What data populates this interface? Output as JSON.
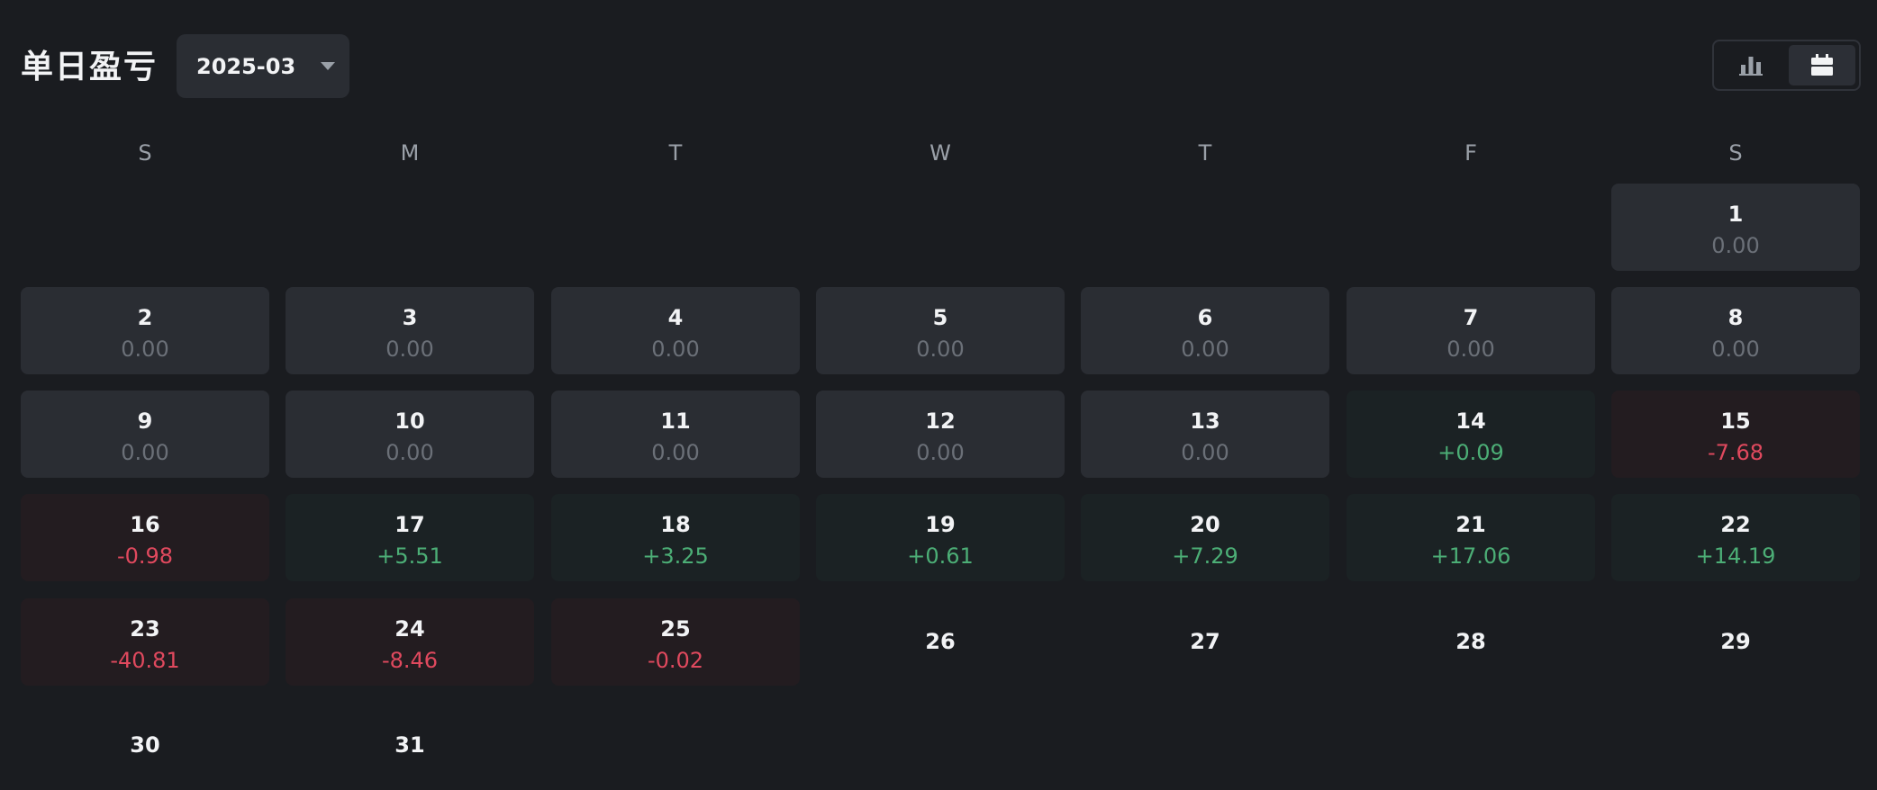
{
  "header": {
    "title": "单日盈亏",
    "month_select": {
      "value": "2025-03",
      "icon": "caret-down-icon"
    },
    "view_toggle": [
      {
        "name": "bar-chart-view",
        "icon": "bar-chart-icon",
        "active": false
      },
      {
        "name": "calendar-view",
        "icon": "calendar-icon",
        "active": true
      }
    ]
  },
  "weekdays": [
    "S",
    "M",
    "T",
    "W",
    "T",
    "F",
    "S"
  ],
  "colors": {
    "background": "#1a1c20",
    "cell_neutral": "#2a2d33",
    "cell_positive": "#1b2224",
    "cell_negative": "#231c20",
    "text_positive": "#4cae76",
    "text_negative": "#e0495e",
    "text_muted": "#6b7078"
  },
  "calendar": {
    "first_weekday_index": 6,
    "days": [
      {
        "day": "1",
        "pnl": "0.00",
        "status": "neutral"
      },
      {
        "day": "2",
        "pnl": "0.00",
        "status": "neutral"
      },
      {
        "day": "3",
        "pnl": "0.00",
        "status": "neutral"
      },
      {
        "day": "4",
        "pnl": "0.00",
        "status": "neutral"
      },
      {
        "day": "5",
        "pnl": "0.00",
        "status": "neutral"
      },
      {
        "day": "6",
        "pnl": "0.00",
        "status": "neutral"
      },
      {
        "day": "7",
        "pnl": "0.00",
        "status": "neutral"
      },
      {
        "day": "8",
        "pnl": "0.00",
        "status": "neutral"
      },
      {
        "day": "9",
        "pnl": "0.00",
        "status": "neutral"
      },
      {
        "day": "10",
        "pnl": "0.00",
        "status": "neutral"
      },
      {
        "day": "11",
        "pnl": "0.00",
        "status": "neutral"
      },
      {
        "day": "12",
        "pnl": "0.00",
        "status": "neutral"
      },
      {
        "day": "13",
        "pnl": "0.00",
        "status": "neutral"
      },
      {
        "day": "14",
        "pnl": "+0.09",
        "status": "pos"
      },
      {
        "day": "15",
        "pnl": "-7.68",
        "status": "neg"
      },
      {
        "day": "16",
        "pnl": "-0.98",
        "status": "neg"
      },
      {
        "day": "17",
        "pnl": "+5.51",
        "status": "pos"
      },
      {
        "day": "18",
        "pnl": "+3.25",
        "status": "pos"
      },
      {
        "day": "19",
        "pnl": "+0.61",
        "status": "pos"
      },
      {
        "day": "20",
        "pnl": "+7.29",
        "status": "pos"
      },
      {
        "day": "21",
        "pnl": "+17.06",
        "status": "pos"
      },
      {
        "day": "22",
        "pnl": "+14.19",
        "status": "pos"
      },
      {
        "day": "23",
        "pnl": "-40.81",
        "status": "neg"
      },
      {
        "day": "24",
        "pnl": "-8.46",
        "status": "neg"
      },
      {
        "day": "25",
        "pnl": "-0.02",
        "status": "neg"
      },
      {
        "day": "26",
        "pnl": "",
        "status": "empty"
      },
      {
        "day": "27",
        "pnl": "",
        "status": "empty"
      },
      {
        "day": "28",
        "pnl": "",
        "status": "empty"
      },
      {
        "day": "29",
        "pnl": "",
        "status": "empty"
      },
      {
        "day": "30",
        "pnl": "",
        "status": "empty"
      },
      {
        "day": "31",
        "pnl": "",
        "status": "empty"
      }
    ]
  }
}
